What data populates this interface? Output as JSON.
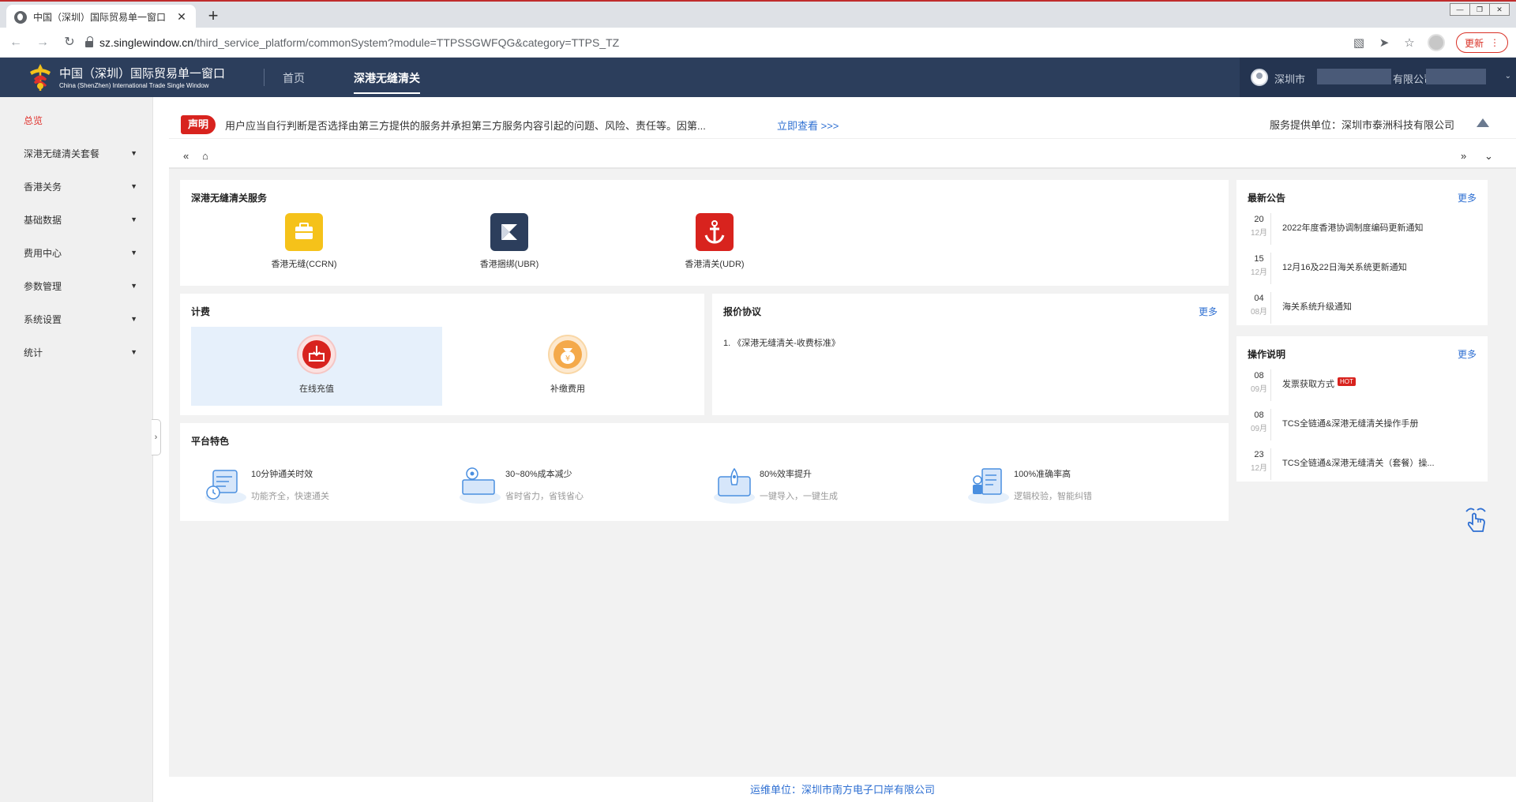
{
  "browser": {
    "tab_title": "中国（深圳）国际贸易单一窗口",
    "tab_close": "✕",
    "new_tab": "+",
    "url_domain": "sz.singlewindow.cn",
    "url_path": "/third_service_platform/commonSystem?module=TTPSSGWFQG&category=TTPS_TZ",
    "update_label": "更新",
    "win_controls": [
      "—",
      "❐",
      "✕"
    ]
  },
  "header": {
    "brand_cn": "中国（深圳）国际贸易单一窗口",
    "brand_en": "China (ShenZhen) International Trade Single Window",
    "nav": [
      {
        "label": "首页",
        "active": false
      },
      {
        "label": "深港无缝清关",
        "active": true
      }
    ],
    "user_prefix": "深圳市",
    "user_suffix": "有限公司"
  },
  "sidebar": {
    "items": [
      {
        "label": "总览",
        "active": true,
        "expandable": false
      },
      {
        "label": "深港无缝清关套餐",
        "expandable": true
      },
      {
        "label": "香港关务",
        "expandable": true
      },
      {
        "label": "基础数据",
        "expandable": true
      },
      {
        "label": "费用中心",
        "expandable": true
      },
      {
        "label": "参数管理",
        "expandable": true
      },
      {
        "label": "系统设置",
        "expandable": true
      },
      {
        "label": "统计",
        "expandable": true
      }
    ]
  },
  "notice": {
    "badge": "声明",
    "text": "用户应当自行判断是否选择由第三方提供的服务并承担第三方服务内容引起的问题、风险、责任等。因第...",
    "link": "立即查看 >>>",
    "provider": "服务提供单位：深圳市泰洲科技有限公司"
  },
  "services": {
    "title": "深港无缝清关服务",
    "items": [
      {
        "label": "香港无缝(CCRN)",
        "color": "#f5c21a",
        "icon": "briefcase-icon"
      },
      {
        "label": "香港捆绑(UBR)",
        "color": "#2c3e5c",
        "icon": "bundle-icon"
      },
      {
        "label": "香港清关(UDR)",
        "color": "#d8231e",
        "icon": "anchor-icon"
      }
    ]
  },
  "billing": {
    "title": "计费",
    "items": [
      {
        "label": "在线充值",
        "icon": "recharge-icon",
        "selected": true
      },
      {
        "label": "补缴费用",
        "icon": "money-bag-icon",
        "selected": false
      }
    ]
  },
  "quote": {
    "title": "报价协议",
    "more": "更多",
    "items": [
      "1. 《深港无缝清关-收费标准》"
    ]
  },
  "features": {
    "title": "平台特色",
    "items": [
      {
        "title": "10分钟通关时效",
        "sub": "功能齐全，快速通关"
      },
      {
        "title": "30~80%成本减少",
        "sub": "省时省力，省钱省心"
      },
      {
        "title": "80%效率提升",
        "sub": "一键导入，一键生成"
      },
      {
        "title": "100%准确率高",
        "sub": "逻辑校验，智能纠错"
      }
    ]
  },
  "announcements": {
    "title": "最新公告",
    "more": "更多",
    "items": [
      {
        "day": "20",
        "month": "12月",
        "text": "2022年度香港协调制度编码更新通知"
      },
      {
        "day": "15",
        "month": "12月",
        "text": "12月16及22日海关系统更新通知"
      },
      {
        "day": "04",
        "month": "08月",
        "text": "海关系统升级通知"
      }
    ]
  },
  "instructions": {
    "title": "操作说明",
    "more": "更多",
    "hot": "HOT",
    "items": [
      {
        "day": "08",
        "month": "09月",
        "text": "发票获取方式",
        "hot": true
      },
      {
        "day": "08",
        "month": "09月",
        "text": "TCS全链通&深港无缝清关操作手册",
        "hot": false
      },
      {
        "day": "23",
        "month": "12月",
        "text": "TCS全链通&深港无缝清关（套餐）操...",
        "hot": false
      }
    ]
  },
  "footer": {
    "text": "运维单位：深圳市南方电子口岸有限公司"
  }
}
